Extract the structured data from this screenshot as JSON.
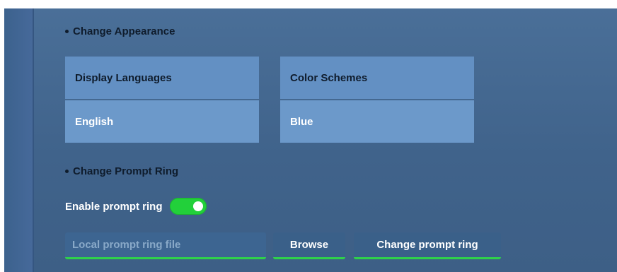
{
  "appearance": {
    "heading": "Change Appearance",
    "table": {
      "headers": [
        "Display Languages",
        "Color Schemes"
      ],
      "values": [
        "English",
        "Blue"
      ]
    }
  },
  "prompt_ring": {
    "heading": "Change Prompt Ring",
    "enable_label": "Enable prompt ring",
    "enabled": true,
    "file_placeholder": "Local prompt ring file",
    "file_value": "",
    "browse_label": "Browse",
    "change_label": "Change prompt ring"
  },
  "colors": {
    "panel_background": "#45698f",
    "cell_header": "#6390c3",
    "cell_value": "#6c99ca",
    "toggle_on": "#22d03a",
    "accent_underline": "#2fd24a"
  }
}
